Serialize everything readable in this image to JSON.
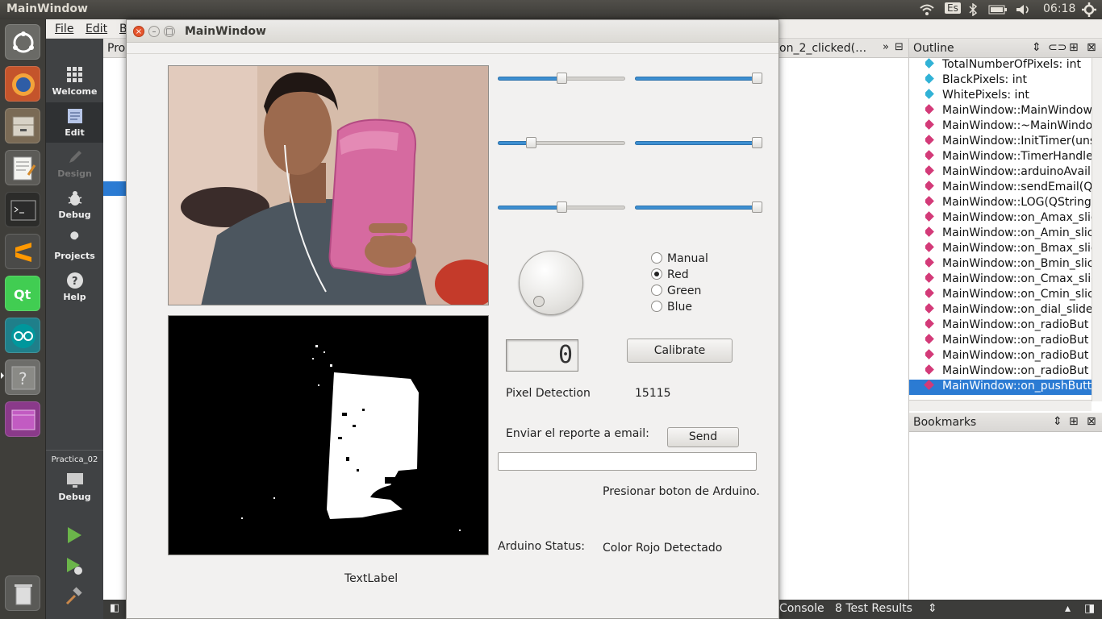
{
  "top_panel": {
    "title": "MainWindow",
    "keyboard": "Es",
    "time": "06:18"
  },
  "creator": {
    "menu": [
      "File",
      "Edit",
      "B"
    ],
    "project_label": "Pro",
    "editor_tab": "on_2_clicked(…",
    "modes": [
      {
        "label": "Welcome",
        "icon": "grid-icon"
      },
      {
        "label": "Edit",
        "icon": "document-icon"
      },
      {
        "label": "Design",
        "icon": "pencil-icon"
      },
      {
        "label": "Debug",
        "icon": "bug-icon"
      },
      {
        "label": "Projects",
        "icon": "wrench-icon"
      },
      {
        "label": "Help",
        "icon": "help-icon"
      }
    ],
    "kit_project": "Practica_02",
    "kit_mode": "Debug",
    "outline_title": "Outline",
    "bookmarks_title": "Bookmarks",
    "outline_items": [
      {
        "label": "TotalNumberOfPixels: int",
        "kind": "var"
      },
      {
        "label": "BlackPixels: int",
        "kind": "var"
      },
      {
        "label": "WhitePixels: int",
        "kind": "var"
      },
      {
        "label": "MainWindow::MainWindow",
        "kind": "fn"
      },
      {
        "label": "MainWindow::~MainWindow",
        "kind": "fn"
      },
      {
        "label": "MainWindow::InitTimer(uns",
        "kind": "fn"
      },
      {
        "label": "MainWindow::TimerHandle",
        "kind": "fn"
      },
      {
        "label": "MainWindow::arduinoAvail",
        "kind": "fn"
      },
      {
        "label": "MainWindow::sendEmail(Q",
        "kind": "fn"
      },
      {
        "label": "MainWindow::LOG(QString,",
        "kind": "fn"
      },
      {
        "label": "MainWindow::on_Amax_slic",
        "kind": "fn"
      },
      {
        "label": "MainWindow::on_Amin_slic",
        "kind": "fn"
      },
      {
        "label": "MainWindow::on_Bmax_slic",
        "kind": "fn"
      },
      {
        "label": "MainWindow::on_Bmin_slic",
        "kind": "fn"
      },
      {
        "label": "MainWindow::on_Cmax_slic",
        "kind": "fn"
      },
      {
        "label": "MainWindow::on_Cmin_slic",
        "kind": "fn"
      },
      {
        "label": "MainWindow::on_dial_slide",
        "kind": "fn"
      },
      {
        "label": "MainWindow::on_radioBut",
        "kind": "fn"
      },
      {
        "label": "MainWindow::on_radioBut",
        "kind": "fn"
      },
      {
        "label": "MainWindow::on_radioBut",
        "kind": "fn"
      },
      {
        "label": "MainWindow::on_radioBut",
        "kind": "fn"
      },
      {
        "label": "MainWindow::on_pushButt",
        "kind": "fn",
        "selected": true
      }
    ],
    "status_tabs": [
      "Console",
      "8  Test Results"
    ]
  },
  "app": {
    "title": "MainWindow",
    "sliders": [
      {
        "name": "amin",
        "value": 0.5
      },
      {
        "name": "amax",
        "value": 1.0
      },
      {
        "name": "bmin",
        "value": 0.24
      },
      {
        "name": "bmax",
        "value": 1.0
      },
      {
        "name": "cmin",
        "value": 0.5
      },
      {
        "name": "cmax",
        "value": 1.0
      }
    ],
    "radio_options": [
      {
        "label": "Manual",
        "checked": false
      },
      {
        "label": "Red",
        "checked": true
      },
      {
        "label": "Green",
        "checked": false
      },
      {
        "label": "Blue",
        "checked": false
      }
    ],
    "lcd_value": "0",
    "calibrate_label": "Calibrate",
    "pixel_detection_label": "Pixel Detection",
    "pixel_detection_value": "15115",
    "email_prompt": "Enviar el reporte a email:",
    "send_label": "Send",
    "email_value": "",
    "arduino_hint": "Presionar boton de Arduino.",
    "arduino_status_label": "Arduino Status:",
    "arduino_status_value": "Color Rojo Detectado",
    "text_label": "TextLabel"
  },
  "colors": {
    "accent": "#3d8fd1",
    "selection": "#2b7bd3",
    "var_icon": "#31b2d6",
    "fn_icon": "#d33a78"
  }
}
